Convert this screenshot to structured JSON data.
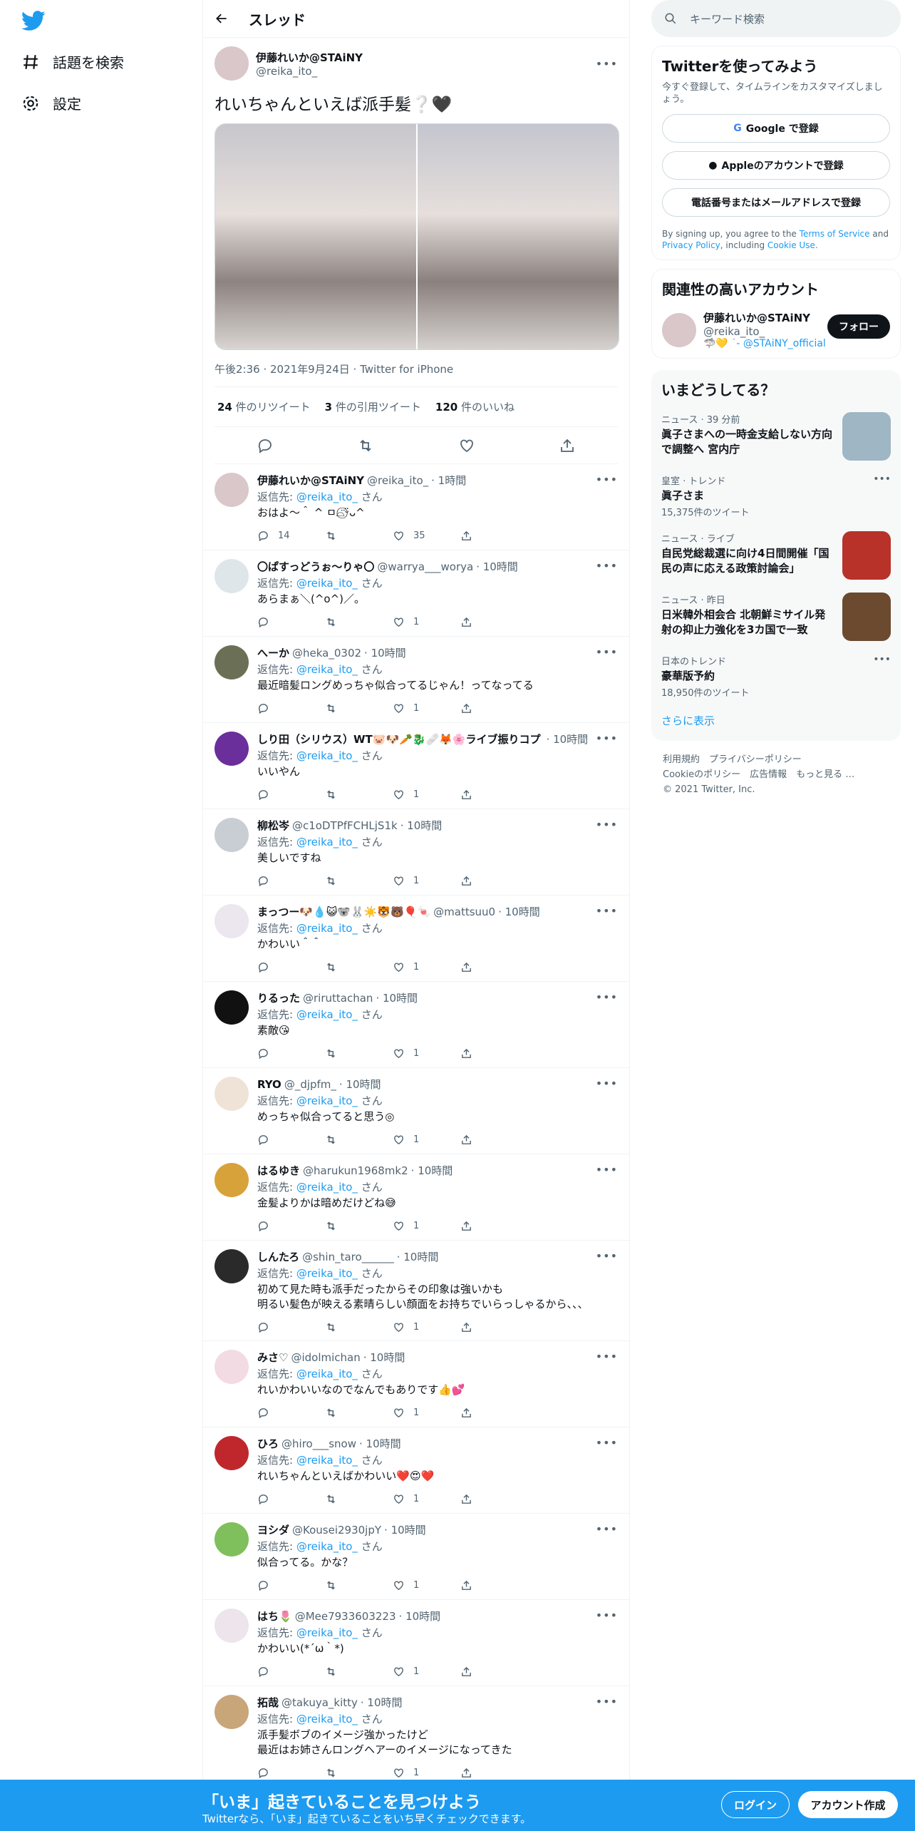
{
  "sidebar": {
    "explore": "話題を検索",
    "settings": "設定"
  },
  "header": {
    "title": "スレッド"
  },
  "focal": {
    "name": "伊藤れいか@STAiNY",
    "handle": "@reika_ito_",
    "text": "れいちゃんといえば派手髪❔🖤",
    "meta": "午後2:36 · 2021年9月24日 · Twitter for iPhone",
    "retweets": "24",
    "retweets_label": "件のリツイート",
    "quotes": "3",
    "quotes_label": "件の引用ツイート",
    "likes": "120",
    "likes_label": "件のいいね"
  },
  "replies": [
    {
      "name": "伊藤れいか@STAiNY",
      "handle": "@reika_ito_",
      "time": "· 1時間",
      "to": "@reika_ito_",
      "text": "おはよ〜＾ ^ ㅁ⌓̈⃝ᵕ̈ᴗ^",
      "reply_count": "14",
      "like_count": "35",
      "av": "#d9c7c9"
    },
    {
      "name": "〇ぱすっどうぉ〜りゃ〇",
      "handle": "@warrya___worya",
      "time": "· 10時間",
      "to": "@reika_ito_",
      "text": "あらまぁ＼(^o^)／。",
      "reply_count": "",
      "like_count": "1",
      "av": "#dfe6ea"
    },
    {
      "name": "へーか",
      "handle": "@heka_0302",
      "time": "· 10時間",
      "to": "@reika_ito_",
      "text": "最近暗髪ロングめっちゃ似合ってるじゃん！ってなってる",
      "reply_count": "",
      "like_count": "1",
      "av": "#6b6f55"
    },
    {
      "name": "しり田（シリウス）WT🐷🐶🥕🐉🩹🦊🌸ライブ振りコプ",
      "handle": "",
      "time": "· 10時間",
      "to": "@reika_ito_",
      "text": "いいやん",
      "reply_count": "",
      "like_count": "1",
      "av": "#6a2f9a"
    },
    {
      "name": "柳松岑",
      "handle": "@c1oDTPfFCHLjS1k",
      "time": "· 10時間",
      "to": "@reika_ito_",
      "text": "美しいですね",
      "reply_count": "",
      "like_count": "1",
      "av": "#c8ced3"
    },
    {
      "name": "まっつー🐶💧😺🐨🐰☀️🐯🐻🎈🍬",
      "handle": "@mattsuu0",
      "time": "· 10時間",
      "to": "@reika_ito_",
      "text": "かわいい＾＾",
      "reply_count": "",
      "like_count": "1",
      "av": "#ece6ee"
    },
    {
      "name": "りるった",
      "handle": "@riruttachan",
      "time": "· 10時間",
      "to": "@reika_ito_",
      "text": "素敵😘",
      "reply_count": "",
      "like_count": "1",
      "av": "#111111"
    },
    {
      "name": "RYO",
      "handle": "@_djpfm_",
      "time": "· 10時間",
      "to": "@reika_ito_",
      "text": "めっちゃ似合ってると思う◎",
      "reply_count": "",
      "like_count": "1",
      "av": "#efe3d8"
    },
    {
      "name": "はるゆき",
      "handle": "@harukun1968mk2",
      "time": "· 10時間",
      "to": "@reika_ito_",
      "text": "金髪よりかは暗めだけどね😅",
      "reply_count": "",
      "like_count": "1",
      "av": "#d8a23a"
    },
    {
      "name": "しんたろ",
      "handle": "@shin_taro______",
      "time": "· 10時間",
      "to": "@reika_ito_",
      "text": "初めて見た時も派手だったからその印象は強いかも\n明るい髪色が映える素晴らしい顔面をお持ちでいらっしゃるから、、、",
      "reply_count": "",
      "like_count": "1",
      "av": "#2a2a2a"
    },
    {
      "name": "みさ♡",
      "handle": "@idolmichan",
      "time": "· 10時間",
      "to": "@reika_ito_",
      "text": "れいかわいいなのでなんでもありです👍💕",
      "reply_count": "",
      "like_count": "1",
      "av": "#f3dbe3"
    },
    {
      "name": "ひろ",
      "handle": "@hiro___snow",
      "time": "· 10時間",
      "to": "@reika_ito_",
      "text": "れいちゃんといえばかわいい❤️😍❤️",
      "reply_count": "",
      "like_count": "1",
      "av": "#c0272d"
    },
    {
      "name": "ヨシダ",
      "handle": "@Kousei2930jpY",
      "time": "· 10時間",
      "to": "@reika_ito_",
      "text": "似合ってる。かな？",
      "reply_count": "",
      "like_count": "1",
      "av": "#7fbf5c"
    },
    {
      "name": "はち🌷",
      "handle": "@Mee7933603223",
      "time": "· 10時間",
      "to": "@reika_ito_",
      "text": "かわいい(*´ω｀*)",
      "reply_count": "",
      "like_count": "1",
      "av": "#ede4ec"
    },
    {
      "name": "拓哉",
      "handle": "@takuya_kitty",
      "time": "· 10時間",
      "to": "@reika_ito_",
      "text": "派手髪ボブのイメージ強かったけど\n最近はお姉さんロングヘアーのイメージになってきた",
      "reply_count": "",
      "like_count": "1",
      "av": "#c9a57a"
    }
  ],
  "replying_label": "返信先:",
  "replying_suffix": "さん",
  "search": {
    "placeholder": "キーワード検索"
  },
  "signup": {
    "title": "Twitterを使ってみよう",
    "subtitle": "今すぐ登録して、タイムラインをカスタマイズしましょう。",
    "google": "Google で登録",
    "apple": "Appleのアカウントで登録",
    "phone": "電話番号またはメールアドレスで登録",
    "legal_pre": "By signing up, you agree to the",
    "tos": "Terms of Service",
    "and": "and",
    "privacy": "Privacy Policy",
    "legal_post": ", including",
    "cookie": "Cookie Use."
  },
  "related": {
    "title": "関連性の高いアカウント",
    "name": "伊藤れいか@STAiNY",
    "handle": "@reika_ito_",
    "bio": "🦈💛 ˙- @STAiNY_official",
    "follow": "フォロー"
  },
  "trends": {
    "title": "いまどうしてる？",
    "items": [
      {
        "cat": "ニュース · 39 分前",
        "title": "眞子さまへの一時金支給しない方向で調整へ 宮内庁",
        "count": ""
      },
      {
        "cat": "皇室 · トレンド",
        "title": "眞子さま",
        "count": "15,375件のツイート"
      },
      {
        "cat": "ニュース · ライブ",
        "title": "自民党総裁選に向け4日間開催「国民の声に応える政策討論会」",
        "count": ""
      },
      {
        "cat": "ニュース · 昨日",
        "title": "日米韓外相会合 北朝鮮ミサイル発射の抑止力強化を3カ国で一致",
        "count": ""
      },
      {
        "cat": "日本のトレンド",
        "title": "豪華版予約",
        "count": "18,950件のツイート"
      }
    ],
    "more": "さらに表示"
  },
  "footer": {
    "l1": "利用規約　プライバシーポリシー",
    "l2": "Cookieのポリシー　広告情報　もっと見る …",
    "l3": "© 2021 Twitter, Inc."
  },
  "bottom": {
    "title": "「いま」起きていることを見つけよう",
    "sub": "Twitterなら、「いま」起きていることをいち早くチェックできます。",
    "login": "ログイン",
    "signup": "アカウント作成"
  },
  "colors": {
    "accent": "#1d9bf0"
  }
}
